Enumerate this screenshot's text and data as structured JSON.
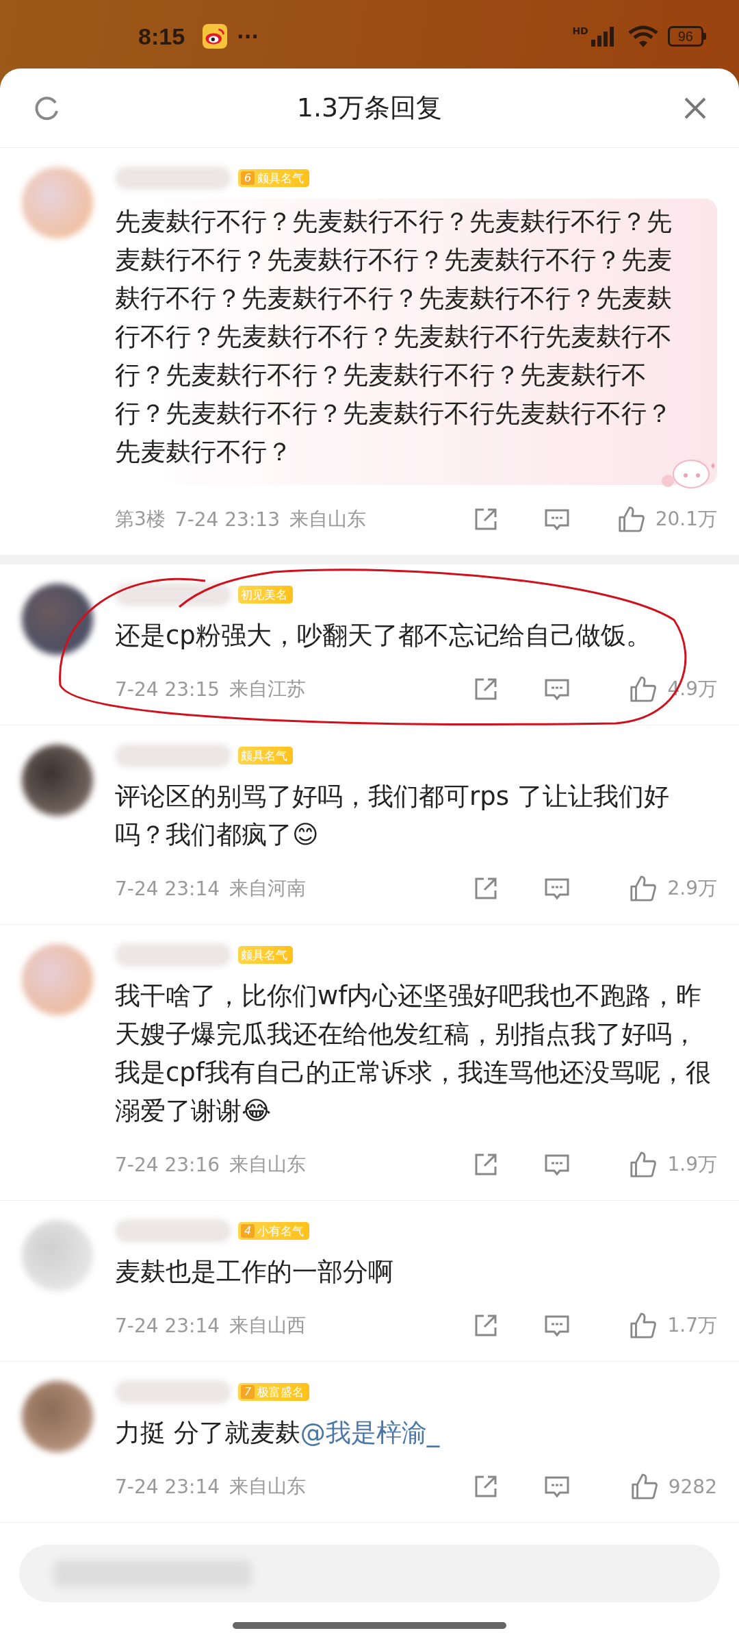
{
  "status_bar": {
    "time": "8:15",
    "more": "···",
    "network": "HD",
    "battery": "96"
  },
  "sheet": {
    "title": "1.3万条回复"
  },
  "comments": [
    {
      "badge": {
        "level": "6",
        "label": "颇具名气"
      },
      "bubble": true,
      "text": "先麦麸行不行？先麦麸行不行？先麦麸行不行？先麦麸行不行？先麦麸行不行？先麦麸行不行？先麦麸行不行？先麦麸行不行？先麦麸行不行？先麦麸行不行？先麦麸行不行？先麦麸行不行先麦麸行不行？先麦麸行不行？先麦麸行不行？先麦麸行不行？先麦麸行不行？先麦麸行不行先麦麸行不行？先麦麸行不行？",
      "floor": "第3楼",
      "time": "7-24 23:13",
      "location": "来自山东",
      "likes": "20.1万"
    },
    {
      "badge": {
        "label": "初见美名"
      },
      "bubble": false,
      "text": "还是cp粉强大，吵翻天了都不忘记给自己做饭。",
      "time": "7-24 23:15",
      "location": "来自江苏",
      "likes": "4.9万"
    },
    {
      "badge": {
        "label": "颇具名气"
      },
      "bubble": false,
      "text": "评论区的别骂了好吗，我们都可rps 了让让我们好吗？我们都疯了😊",
      "time": "7-24 23:14",
      "location": "来自河南",
      "likes": "2.9万"
    },
    {
      "badge": {
        "label": "颇具名气"
      },
      "bubble": false,
      "text": "我干啥了，比你们wf内心还坚强好吧我也不跑路，昨天嫂子爆完瓜我还在给他发红稿，别指点我了好吗，我是cpf我有自己的正常诉求，我连骂他还没骂呢，很溺爱了谢谢😂",
      "time": "7-24 23:16",
      "location": "来自山东",
      "likes": "1.9万"
    },
    {
      "badge": {
        "level": "4",
        "label": "小有名气"
      },
      "bubble": false,
      "text": "麦麸也是工作的一部分啊",
      "time": "7-24 23:14",
      "location": "来自山西",
      "likes": "1.7万"
    },
    {
      "badge": {
        "level": "7",
        "label": "极富盛名"
      },
      "bubble": false,
      "text": "力挺 分了就麦麸",
      "mention": "@我是梓渝_",
      "time": "7-24 23:14",
      "location": "来自山东",
      "likes": "9282"
    }
  ]
}
